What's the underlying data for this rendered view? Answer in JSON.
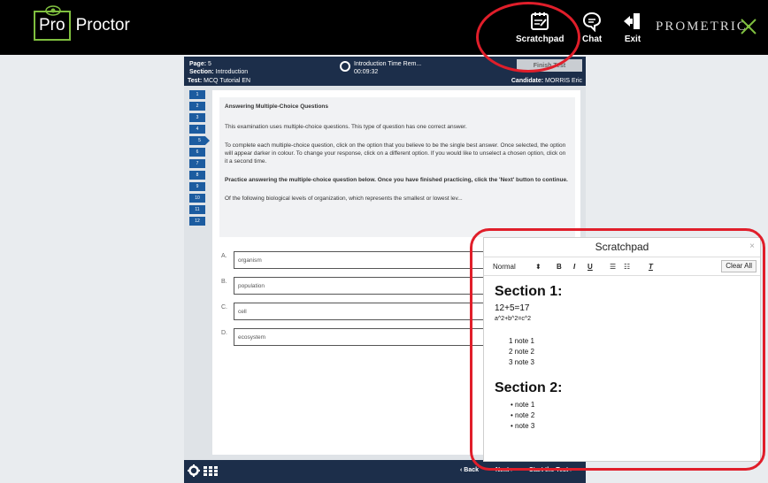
{
  "topbar": {
    "logo_left": "Pro",
    "logo_right": "Proctor",
    "scratchpad_label": "Scratchpad",
    "chat_label": "Chat",
    "exit_label": "Exit",
    "brand": "PROMETRIC"
  },
  "exam": {
    "page_label": "Page:",
    "page_value": "5",
    "section_label": "Section:",
    "section_value": "Introduction",
    "test_label": "Test:",
    "test_value": "MCQ Tutorial EN",
    "timer_title": "Introduction Time Rem...",
    "timer_value": "00:09:32",
    "finish_label": "Finish Test",
    "candidate_label": "Candidate:",
    "candidate_value": "MORRIS Eric",
    "question_numbers": [
      "1",
      "2",
      "3",
      "4",
      "5",
      "6",
      "7",
      "8",
      "9",
      "10",
      "11",
      "12"
    ],
    "active_question": "5",
    "q_title": "Answering Multiple-Choice Questions",
    "q_p1": "This examination uses multiple-choice questions. This type of question has one correct answer.",
    "q_p2": "To complete each multiple-choice question, click on the option that you believe to be the single best answer. Once selected, the option will appear darker in colour. To change your response, click on a different option. If you would like to unselect a chosen option, click on it a second time.",
    "q_p3": "Practice answering the multiple-choice question below. Once you have finished practicing, click the 'Next' button to continue.",
    "q_p4": "Of the following biological levels of organization, which represents the smallest or lowest lev...",
    "options": [
      {
        "letter": "A.",
        "text": "organism"
      },
      {
        "letter": "B.",
        "text": "population"
      },
      {
        "letter": "C.",
        "text": "cell"
      },
      {
        "letter": "D.",
        "text": "ecosystem"
      }
    ],
    "back_label": "Back",
    "next_label": "Next",
    "start_label": "Start the Test"
  },
  "scratchpad": {
    "title": "Scratchpad",
    "close": "×",
    "format": "Normal",
    "bold": "B",
    "italic": "I",
    "underline": "U",
    "clear_format": "T",
    "clear_all": "Clear All",
    "section1": "Section 1:",
    "equation": "12+5=17",
    "formula": "a^2+b^2=c^2",
    "numbered": [
      "1 note 1",
      "2 note 2",
      "3 note 3"
    ],
    "section2": "Section 2:",
    "bullets": [
      "note 1",
      "note 2",
      "note 3"
    ]
  },
  "colors": {
    "accent_green": "#7fbf3f",
    "header_navy": "#1c2e4a",
    "nav_blue": "#1c5ca0",
    "highlight_red": "#e01e2a"
  }
}
